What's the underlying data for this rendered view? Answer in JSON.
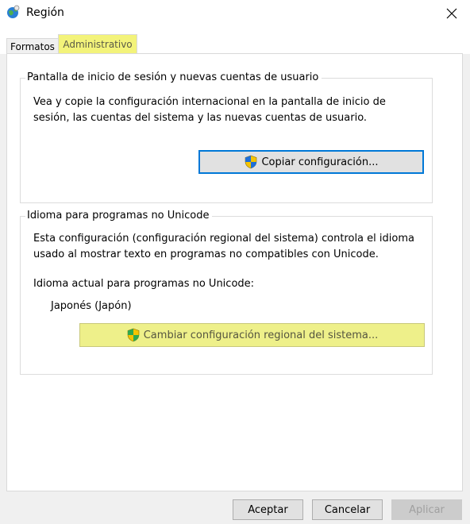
{
  "window": {
    "title": "Región",
    "icon": "globe-icon",
    "close_icon": "close-icon"
  },
  "tabs": [
    {
      "label": "Formatos",
      "selected": false
    },
    {
      "label": "Administrativo",
      "selected": true
    }
  ],
  "login_group": {
    "legend": "Pantalla de inicio de sesión y nuevas cuentas de usuario",
    "description": "Vea y copie la configuración internacional en la pantalla de inicio de sesión, las cuentas del sistema y las nuevas cuentas de usuario.",
    "copy_button": "Copiar configuración..."
  },
  "unicode_group": {
    "legend": "Idioma para programas no Unicode",
    "description": "Esta configuración (configuración regional del sistema) controla el idioma usado al mostrar texto en programas no compatibles con Unicode.",
    "current_label": "Idioma actual para programas no Unicode:",
    "current_value": "Japonés (Japón)",
    "change_button": "Cambiar configuración regional del sistema..."
  },
  "footer": {
    "ok": "Aceptar",
    "cancel": "Cancelar",
    "apply": "Aplicar"
  },
  "colors": {
    "highlight": "#f3f37a",
    "focus_border": "#0078d7"
  }
}
